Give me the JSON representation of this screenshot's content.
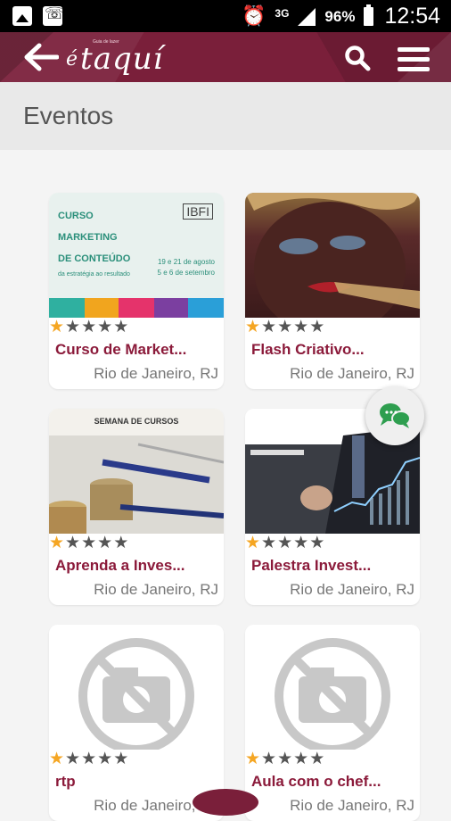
{
  "status_bar": {
    "network": "3G",
    "battery": "96%",
    "time": "12:54"
  },
  "app": {
    "logo_text": "taquí",
    "logo_prefix": "é",
    "logo_small": "Guia de lazer"
  },
  "page": {
    "title": "Eventos"
  },
  "events": [
    {
      "title": "Curso de Market...",
      "location": "Rio de Janeiro, RJ",
      "rating": 1,
      "image": "Curso Marketing de Conteúdo"
    },
    {
      "title": "Flash Criativo...",
      "location": "Rio de Janeiro, RJ",
      "rating": 1,
      "image": "portrait"
    },
    {
      "title": "Aprenda a Inves...",
      "location": "Rio de Janeiro, RJ",
      "rating": 1,
      "image": "Semana de Cursos"
    },
    {
      "title": "Palestra Invest...",
      "location": "Rio de Janeiro, RJ",
      "rating": 1,
      "image": "chart"
    },
    {
      "title": "rtp",
      "location": "Rio de Janeiro, RJ",
      "rating": 1,
      "image": "no-image-icon"
    },
    {
      "title": "Aula com o chef...",
      "location": "Rio de Janeiro, RJ",
      "rating": 1,
      "image": "no-image-icon"
    }
  ],
  "thumbnail_text": {
    "curso": [
      "CURSO",
      "MARKETING",
      "DE CONTEÚDO",
      "da estratégia ao resultado"
    ],
    "curso_logo": "IBFI",
    "curso_dates": [
      "19 e 21 de agosto",
      "5 e 6 de setembro"
    ],
    "aprenda_head": "SEMANA DE CURSOS"
  },
  "colors": {
    "appbar": "#7a1f3a",
    "title": "#8b1a3a",
    "star_on": "#f5a623",
    "star_off": "#555555",
    "fab_icon": "#2e9e4f"
  },
  "icons": [
    "back-arrow-icon",
    "search-icon",
    "hamburger-menu-icon",
    "chat-icon",
    "no-image-camera-icon",
    "star-icon"
  ]
}
